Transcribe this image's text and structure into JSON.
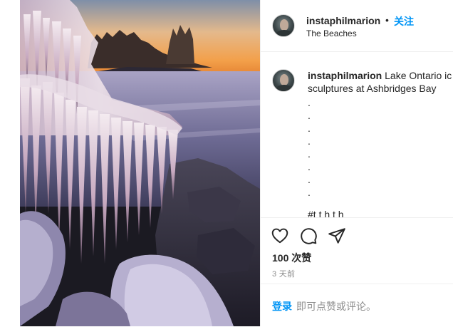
{
  "header": {
    "username": "instaphilmarion",
    "separator": "•",
    "follow_label": "关注",
    "location": "The Beaches"
  },
  "caption": {
    "username": "instaphilmarion",
    "text_line1": " Lake Ontario ic",
    "text_line2": "sculptures at Ashbridges Bay",
    "dots": [
      ".",
      ".",
      ".",
      ".",
      ".",
      ".",
      ".",
      "."
    ],
    "tags_partial": "#t       t  h t      h"
  },
  "actions": {
    "like_icon": "heart-icon",
    "comment_icon": "comment-icon",
    "share_icon": "paper-plane-icon",
    "likes_text": "100 次赞",
    "time_text": "3 天前"
  },
  "footer": {
    "login_label": "登录",
    "login_hint": "即可点赞或评论。"
  },
  "colors": {
    "accent": "#0095f6",
    "text": "#262626",
    "muted": "#8e8e8e",
    "divider": "#efefef"
  }
}
